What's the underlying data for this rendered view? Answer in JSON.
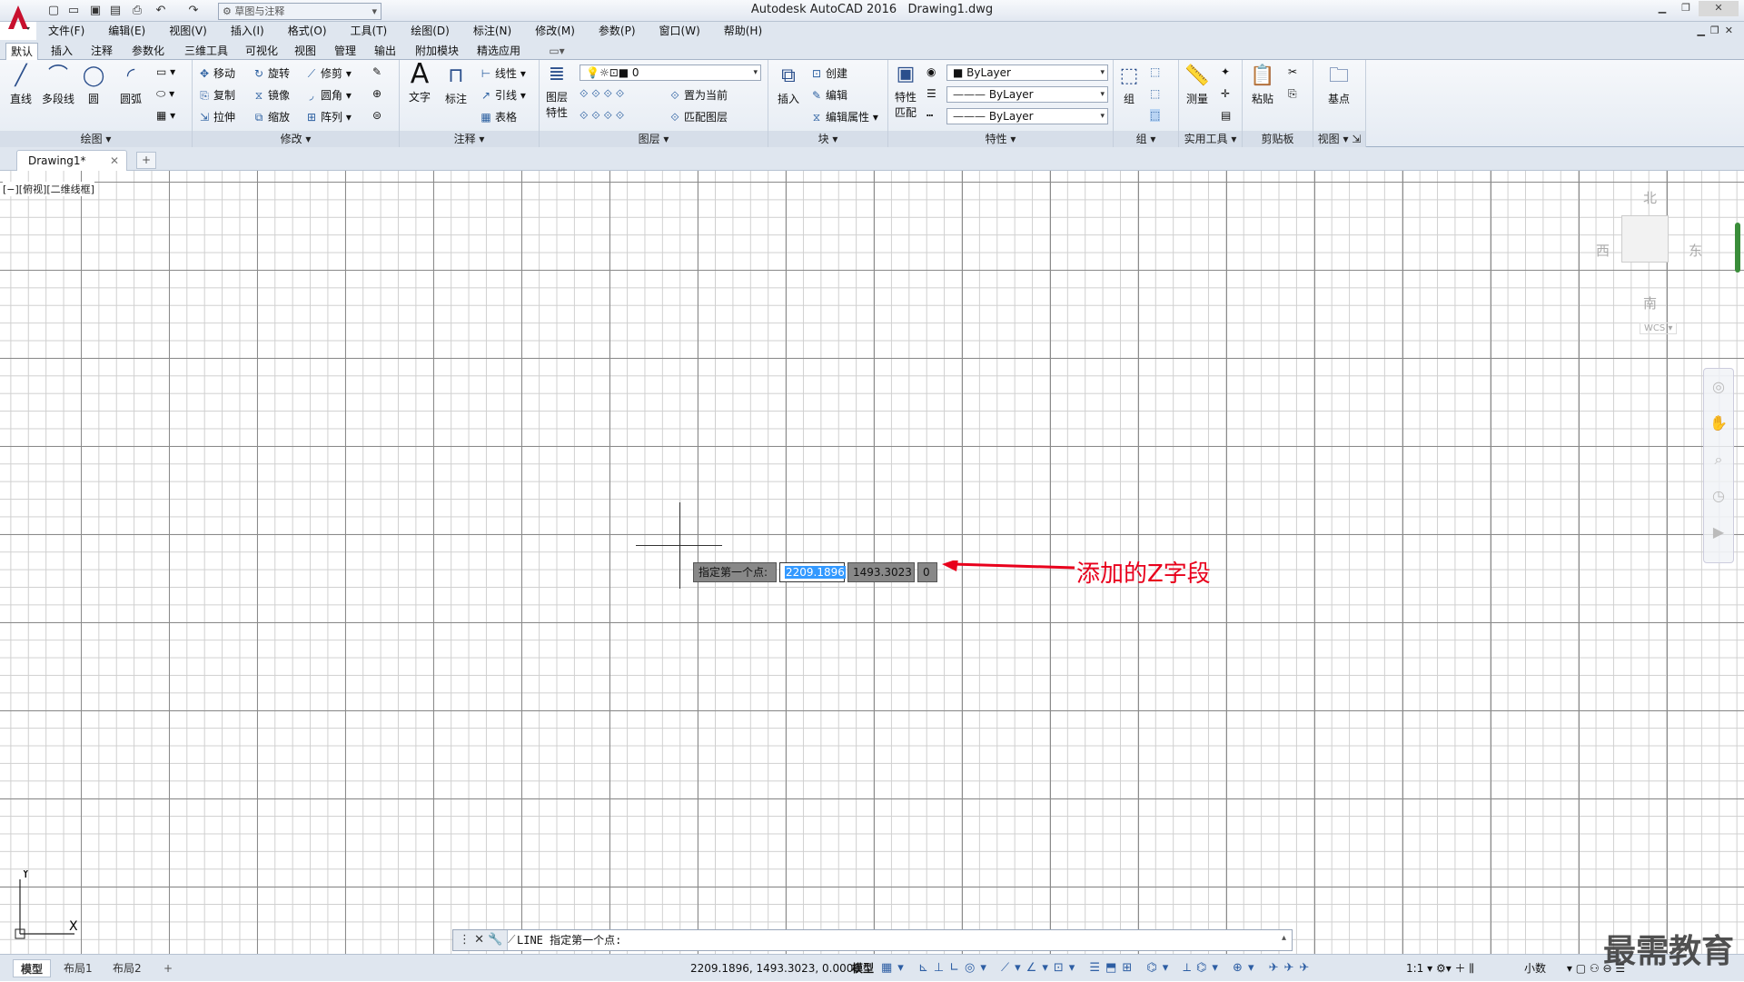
{
  "title_bar": {
    "app_name": "Autodesk AutoCAD 2016",
    "doc_name": "Drawing1.dwg",
    "workspace": "草图与注释"
  },
  "menu": [
    "文件(F)",
    "编辑(E)",
    "视图(V)",
    "插入(I)",
    "格式(O)",
    "工具(T)",
    "绘图(D)",
    "标注(N)",
    "修改(M)",
    "参数(P)",
    "窗口(W)",
    "帮助(H)"
  ],
  "ribbon_tabs": [
    "默认",
    "插入",
    "注释",
    "参数化",
    "三维工具",
    "可视化",
    "视图",
    "管理",
    "输出",
    "附加模块",
    "精选应用"
  ],
  "draw": {
    "line": "直线",
    "polyline": "多段线",
    "circle": "圆",
    "arc": "圆弧",
    "title": "绘图"
  },
  "modify": {
    "move": "移动",
    "rotate": "旋转",
    "trim": "修剪",
    "copy": "复制",
    "mirror": "镜像",
    "fillet": "圆角",
    "stretch": "拉伸",
    "scale": "缩放",
    "array": "阵列",
    "title": "修改"
  },
  "annotation": {
    "text": "文字",
    "dimension": "标注",
    "linear": "线性",
    "leader": "引线",
    "table": "表格",
    "title": "注释"
  },
  "layers": {
    "properties_1": "图层",
    "properties_2": "特性",
    "current_layer": "0",
    "set_current": "置为当前",
    "match": "匹配图层",
    "title": "图层"
  },
  "block": {
    "insert": "插入",
    "create": "创建",
    "edit": "编辑",
    "edit_attr": "编辑属性",
    "title": "块"
  },
  "properties": {
    "match_1": "特性",
    "match_2": "匹配",
    "color": "ByLayer",
    "linetype": "ByLayer",
    "lineweight": "ByLayer",
    "title": "特性"
  },
  "groups": {
    "group": "组",
    "title": "组"
  },
  "utilities": {
    "measure": "测量",
    "title": "实用工具"
  },
  "clipboard": {
    "paste": "粘贴",
    "title": "剪贴板"
  },
  "view_panel": {
    "base": "基点",
    "title": "视图"
  },
  "doc_tab": {
    "name": "Drawing1*",
    "close": "✕",
    "new": "+"
  },
  "viewport_label": "[−][俯视][二维线框]",
  "viewcube": {
    "north": "北",
    "south": "南",
    "east": "东",
    "west": "西",
    "wcs": "WCS"
  },
  "dynamic_input": {
    "prompt": "指定第一个点:",
    "x": "2209.1896",
    "y": "1493.3023",
    "z": "0"
  },
  "annotation_callout": "添加的Z字段",
  "ucs": {
    "y": "Y",
    "x": "X"
  },
  "command_line": {
    "text": "LINE 指定第一个点:"
  },
  "layout_tabs": [
    "模型",
    "布局1",
    "布局2"
  ],
  "status": {
    "coords": "2209.1896, 1493.3023, 0.0000",
    "space": "模型",
    "scale": "1:1",
    "units": "小数"
  },
  "watermark": "最需教育",
  "colors": {
    "annotation": "#e8001c",
    "selection": "#3399ff",
    "accent": "#2b5fa0"
  }
}
